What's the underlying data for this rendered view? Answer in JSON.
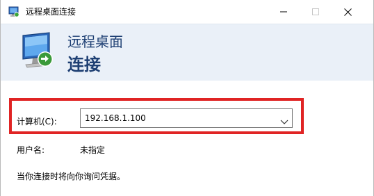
{
  "window": {
    "title": "远程桌面连接"
  },
  "header": {
    "line1": "远程桌面",
    "line2": "连接"
  },
  "form": {
    "computer_label": "计算机(C):",
    "computer_value": "192.168.1.100",
    "user_label": "用户名:",
    "user_value": "未指定",
    "hint": "当你连接时将向你询问凭据。"
  },
  "icons": {
    "app": "remote-desktop-icon",
    "header": "monitor-connection-icon",
    "minimize": "minimize-icon",
    "maximize": "maximize-icon",
    "close": "close-icon",
    "dropdown": "chevron-down-icon"
  },
  "colors": {
    "header_bg": "#eaf0f8",
    "header_text": "#1e3f73",
    "highlight_frame": "#e02424"
  }
}
